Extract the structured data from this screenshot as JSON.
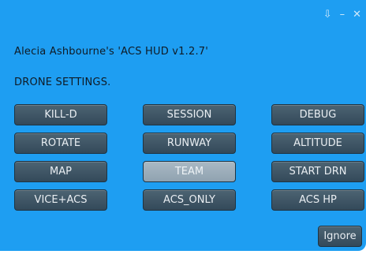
{
  "window": {
    "controls": [
      {
        "name": "pin-icon",
        "glyph": "⇩"
      },
      {
        "name": "minimize-icon",
        "glyph": "–"
      },
      {
        "name": "close-icon",
        "glyph": "✕"
      }
    ]
  },
  "message": {
    "owner_line": "Alecia Ashbourne's 'ACS HUD v1.2.7'",
    "heading": "DRONE SETTINGS."
  },
  "buttons": [
    {
      "label": "KILL-D"
    },
    {
      "label": "SESSION"
    },
    {
      "label": "DEBUG"
    },
    {
      "label": "ROTATE"
    },
    {
      "label": "RUNWAY"
    },
    {
      "label": "ALTITUDE"
    },
    {
      "label": "MAP"
    },
    {
      "label": "TEAM",
      "highlighted": true
    },
    {
      "label": "START DRN"
    },
    {
      "label": "VICE+ACS"
    },
    {
      "label": "ACS_ONLY"
    },
    {
      "label": "ACS HP"
    }
  ],
  "footer": {
    "ignore_label": "Ignore"
  },
  "colors": {
    "dialog_bg": "#1e9ef2",
    "button_bg": "#3f5666",
    "button_highlight_bg": "#9cadb9",
    "button_text": "#e9eef2"
  }
}
